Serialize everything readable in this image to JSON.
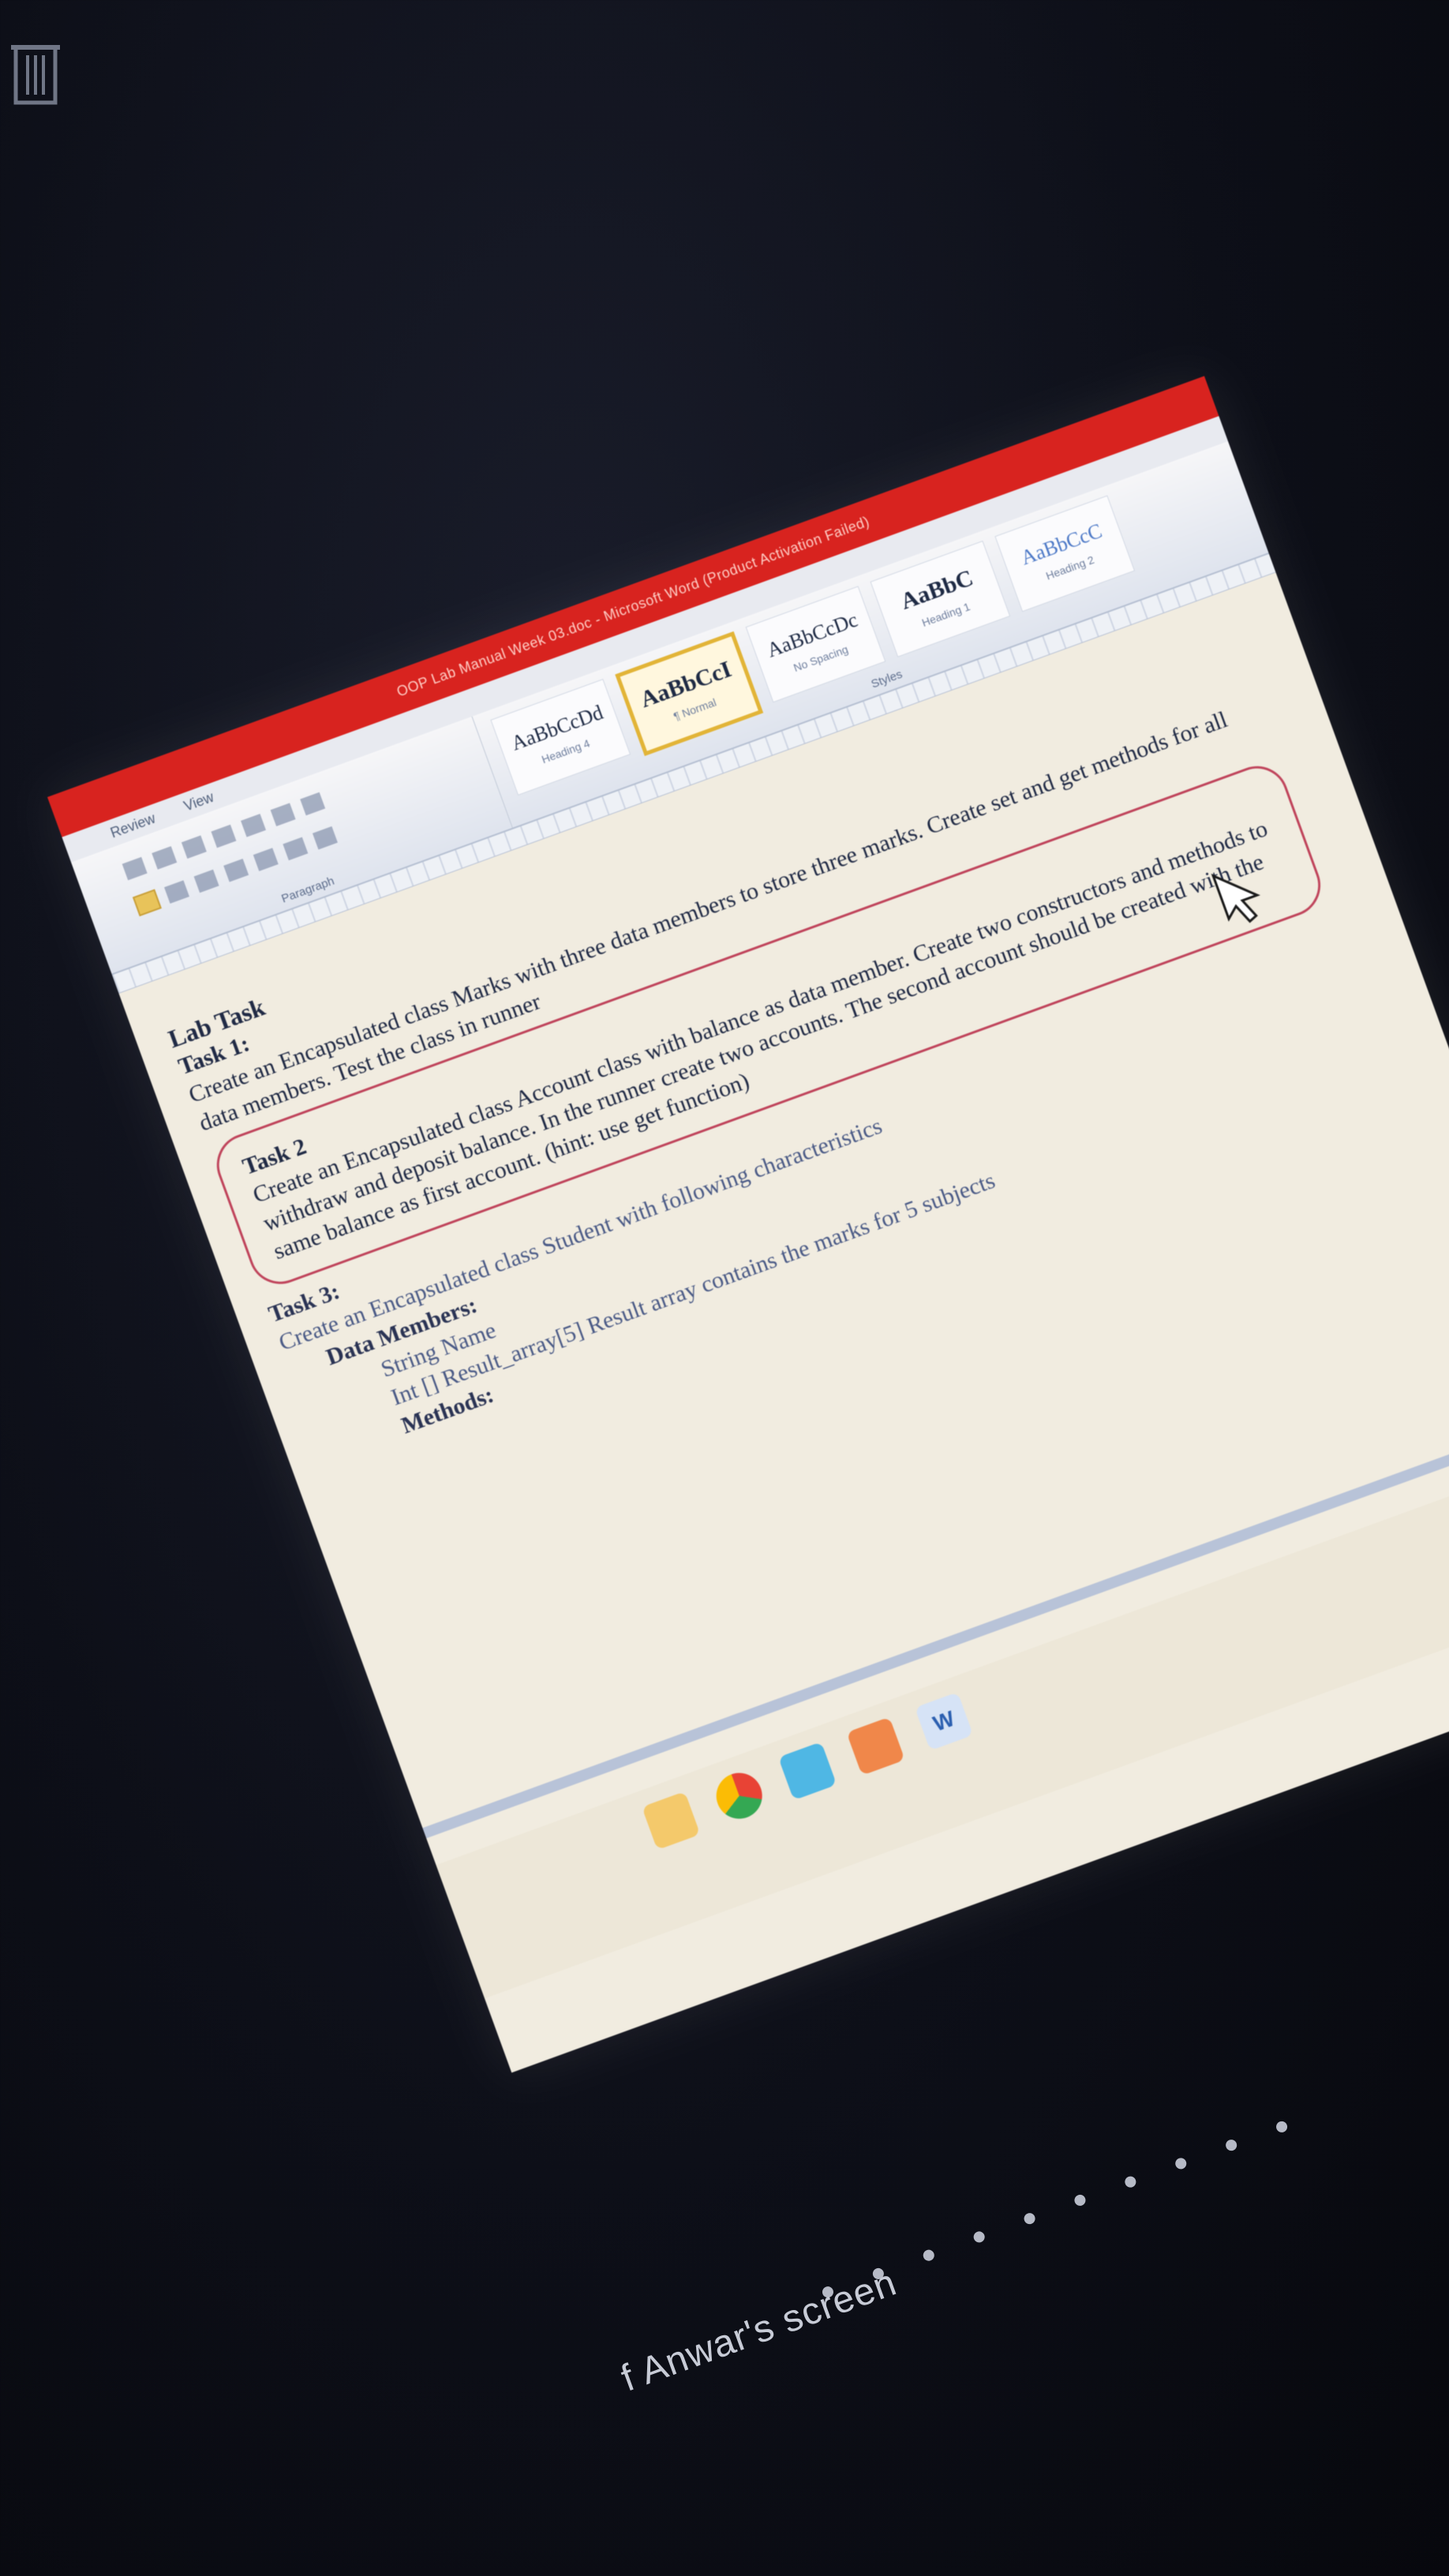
{
  "window": {
    "title": "OOP Lab Manual Week 03.doc - Microsoft Word (Product Activation Failed)"
  },
  "ribbon": {
    "tabs": [
      "Review",
      "View"
    ],
    "paragraph_label": "Paragraph",
    "styles_label": "Styles",
    "styles": [
      {
        "sample": "AaBbCcDd",
        "name": "Heading 4"
      },
      {
        "sample": "AaBbCcI",
        "name": "¶ Normal"
      },
      {
        "sample": "AaBbCcDc",
        "name": "No Spacing"
      },
      {
        "sample": "AaBbC",
        "name": "Heading 1"
      },
      {
        "sample": "AaBbCcC",
        "name": "Heading 2"
      }
    ]
  },
  "document": {
    "heading": "Lab Task",
    "task1": {
      "title": "Task 1:",
      "text": "Create an Encapsulated class Marks with three data members to store three marks. Create set and get methods for all data members. Test the class in runner"
    },
    "task2": {
      "title": "Task 2",
      "text": "Create an Encapsulated class Account class with balance as data member. Create two constructors and methods to withdraw and deposit balance. In the runner create two accounts. The second account should be created with the same balance as first account. (hint: use get function)"
    },
    "task3": {
      "title": "Task 3:",
      "text": "Create an Encapsulated class Student with following characteristics",
      "data_members_label": "Data Members:",
      "member1": "String Name",
      "member2": "Int [] Result_array[5]     Result array contains the marks for 5 subjects",
      "methods_label": "Methods:"
    }
  },
  "taskbar": {
    "icons": [
      "folder-icon",
      "chrome-icon",
      "app-icon",
      "app-icon-2",
      "word-icon"
    ],
    "word_glyph": "W"
  },
  "overlay": {
    "screen_share_text": "f Anwar's screen"
  }
}
